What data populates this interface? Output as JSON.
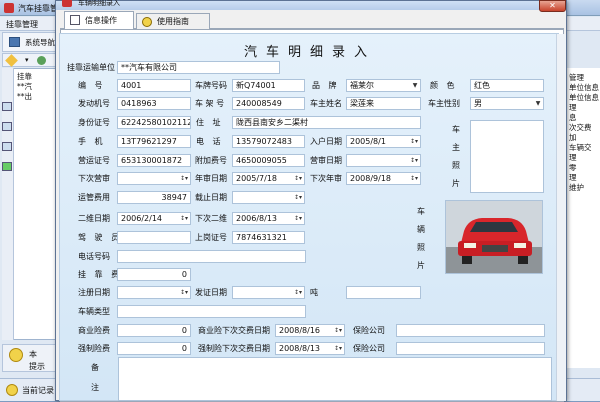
{
  "background": {
    "window_title": "汽车挂靠管",
    "menu_label": "挂靠管理",
    "nav_label": "系统导航",
    "tree_items": [
      "挂靠",
      "**汽",
      "**出"
    ],
    "tip_label": "提示",
    "tip_extra": "本",
    "status_label": "当前记录",
    "right_list": [
      "管理",
      "单位信息",
      "单位信息",
      "理",
      "息",
      "次交费",
      "加",
      "车辆交",
      "理",
      "零",
      "理",
      "维护"
    ]
  },
  "dialog": {
    "title": "车辆明细录入",
    "close_symbol": "✕",
    "tabs": [
      {
        "label": "信息操作",
        "icon": "doc-icon",
        "selected": true
      },
      {
        "label": "使用指南",
        "icon": "help-icon",
        "selected": false
      }
    ]
  },
  "form": {
    "heading": "汽车明细录入",
    "company": {
      "label": "挂靠运输单位",
      "value": "**汽车有限公司"
    },
    "serial": {
      "label": "编 号",
      "value": "4001"
    },
    "plate": {
      "label": "车牌号码",
      "value": "新Q74001"
    },
    "brand": {
      "label": "品 牌",
      "value": "福莱尔"
    },
    "color": {
      "label": "颜 色",
      "value": "红色"
    },
    "engine": {
      "label": "发动机号",
      "value": "0418963"
    },
    "frame": {
      "label": "车 架 号",
      "value": "240008549"
    },
    "owner_name": {
      "label": "车主姓名",
      "value": "梁莲来"
    },
    "owner_gender": {
      "label": "车主性别",
      "value": "男"
    },
    "id_no": {
      "label": "身份证号",
      "value": "622425801021121"
    },
    "address": {
      "label": "住 址",
      "value": "陇西县南安乡二渠村"
    },
    "mobile": {
      "label": "手 机",
      "value": "13T79621297"
    },
    "phone": {
      "label": "电 话",
      "value": "13579072483"
    },
    "entry_date": {
      "label": "入户日期",
      "value": "2005/8/1"
    },
    "owner_photo_label": "车主照片",
    "license": {
      "label": "营运证号",
      "value": "653130001872"
    },
    "extra_no": {
      "label": "附加费号",
      "value": "4650009055"
    },
    "review_date": {
      "label": "营审日期",
      "value": ""
    },
    "next_review": {
      "label": "下次营审",
      "value": ""
    },
    "annual_date": {
      "label": "年审日期",
      "value": "2005/7/18"
    },
    "next_annual": {
      "label": "下次年审",
      "value": "2008/9/18"
    },
    "mgmt_fee": {
      "label": "运管费用",
      "value": "38947"
    },
    "carry_date": {
      "label": "载止日期",
      "value": ""
    },
    "maint_date": {
      "label": "二维日期",
      "value": "2006/2/14"
    },
    "next_maint": {
      "label": "下次二维",
      "value": "2006/8/13"
    },
    "vehicle_photo_label": "车辆照片",
    "driver": {
      "label": "驾 驶 员",
      "value": ""
    },
    "register_no": {
      "label": "上岗证号",
      "value": "7874631321"
    },
    "driver_phone": {
      "label": "电话号码",
      "value": ""
    },
    "hang_fee": {
      "label": "挂 靠 费",
      "value": "0"
    },
    "reg_date": {
      "label": "注册日期",
      "value": ""
    },
    "cert_date": {
      "label": "发证日期",
      "value": ""
    },
    "tonnage": {
      "label": "吨 位",
      "value": ""
    },
    "vehicle_type": {
      "label": "车辆类型",
      "value": ""
    },
    "commercial_ins": {
      "label": "商业险费",
      "value": "0"
    },
    "commercial_next": {
      "label": "商业险下次交费日期",
      "value": "2008/8/16"
    },
    "ins_company1": {
      "label": "保险公司",
      "value": ""
    },
    "compulsory_ins": {
      "label": "强制险费",
      "value": "0"
    },
    "compulsory_next": {
      "label": "强制险下次交费日期",
      "value": "2008/8/13"
    },
    "ins_company2": {
      "label": "保险公司",
      "value": ""
    },
    "remark_label": "备注",
    "dropdown_symbol": "▼",
    "spin_symbol": "↕▾"
  }
}
